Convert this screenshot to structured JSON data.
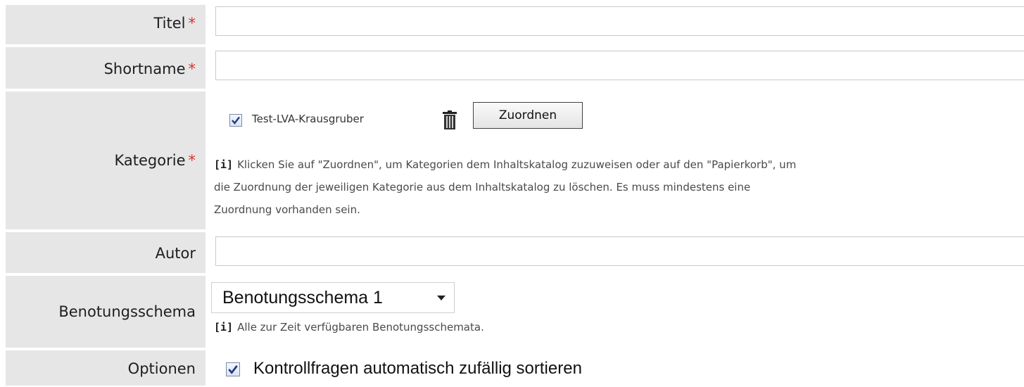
{
  "fields": {
    "titel": {
      "label": "Titel",
      "required_mark": "*",
      "value": ""
    },
    "shortname": {
      "label": "Shortname",
      "required_mark": "*",
      "value": ""
    },
    "kategorie": {
      "label": "Kategorie",
      "required_mark": "*",
      "assigned_category": "Test-LVA-Krausgruber",
      "assigned_checked": true,
      "assign_button": "Zuordnen",
      "info_marker": "[i]",
      "info_line1": "Klicken Sie auf \"Zuordnen\", um Kategorien dem Inhaltskatalog zuzuweisen oder auf den \"Papierkorb\", um",
      "info_line2": "die Zuordnung der jeweiligen Kategorie aus dem Inhaltskatalog zu löschen. Es muss mindestens eine",
      "info_line3": "Zuordnung vorhanden sein."
    },
    "autor": {
      "label": "Autor",
      "value": ""
    },
    "benotungsschema": {
      "label": "Benotungsschema",
      "selected": "Benotungsschema 1",
      "info_marker": "[i]",
      "info": "Alle zur Zeit verfügbaren Benotungsschemata."
    },
    "optionen": {
      "label": "Optionen",
      "checkbox_label": "Kontrollfragen automatisch zufällig sortieren",
      "checked": true
    }
  },
  "icons": {
    "trash": "trash-icon",
    "checkmark": "checkmark-icon",
    "dropdown": "chevron-down-icon"
  },
  "colors": {
    "label_bg": "#e6e6e6",
    "required": "#d9352c",
    "checkbox_border": "#7a8aa8",
    "checkmark": "#1f3b8a"
  }
}
